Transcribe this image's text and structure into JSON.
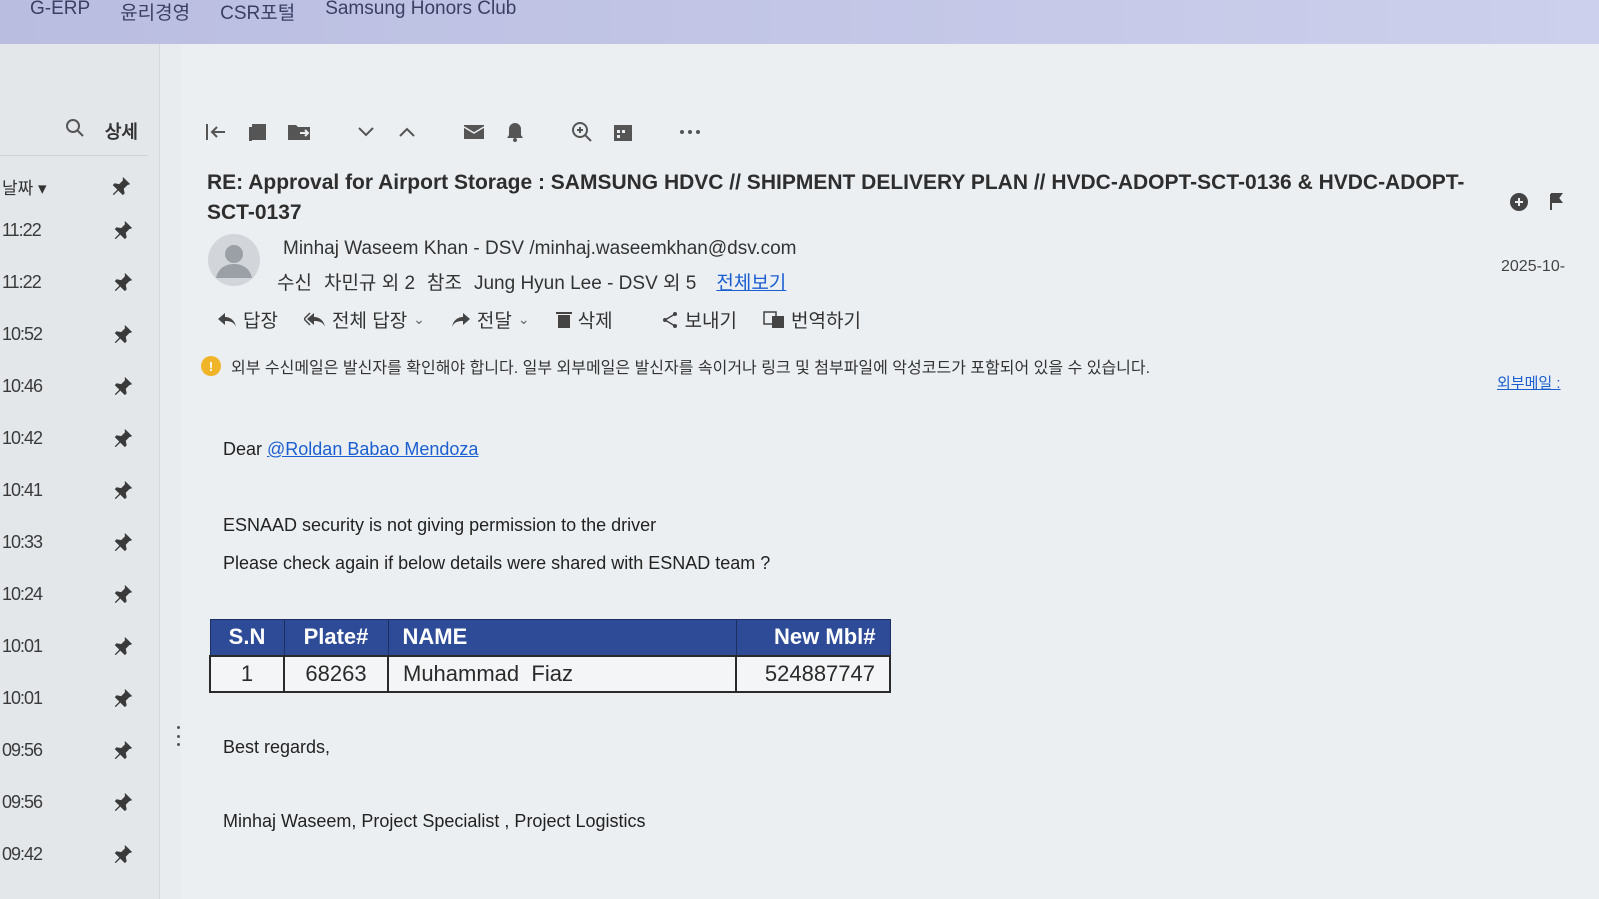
{
  "bookmarks": [
    "G-ERP",
    "윤리경영",
    "CSR포털",
    "Samsung Honors Club"
  ],
  "list_pane": {
    "detail_label": "상세",
    "sort_label": "날짜",
    "times": [
      "11:22",
      "11:22",
      "10:52",
      "10:46",
      "10:42",
      "10:41",
      "10:33",
      "10:24",
      "10:01",
      "10:01",
      "09:56",
      "09:56",
      "09:42"
    ]
  },
  "email": {
    "subject": "RE: Approval for Airport Storage : SAMSUNG HDVC // SHIPMENT DELIVERY PLAN // HVDC-ADOPT-SCT-0136 & HVDC-ADOPT-SCT-0137",
    "sender": "Minhaj Waseem Khan - DSV /minhaj.waseemkhan@dsv.com",
    "to_label": "수신",
    "to_value": "차민규 외 2",
    "cc_label": "참조",
    "cc_value": "Jung Hyun Lee - DSV 외 5",
    "view_all": "전체보기",
    "date": "2025-10-",
    "actions": {
      "reply": "답장",
      "reply_all": "전체 답장",
      "forward": "전달",
      "delete": "삭제",
      "send": "보내기",
      "translate": "번역하기"
    },
    "warning": "외부 수신메일은 발신자를 확인해야 합니다. 일부 외부메일은 발신자를 속이거나 링크 및 첨부파일에 악성코드가 포함되어 있을 수 있습니다.",
    "warning_link": "외부메일 :",
    "body": {
      "greeting": "Dear ",
      "mention": "@Roldan Babao Mendoza",
      "line1": "ESNAAD security is not giving permission to the driver",
      "line2": "Please check again if below details were shared with ESNAD team ?",
      "closing": "Best regards,",
      "signature": "Minhaj Waseem, Project Specialist , Project Logistics"
    },
    "table": {
      "headers": [
        "S.N",
        "Plate#",
        "NAME",
        "New Mbl#"
      ],
      "rows": [
        [
          "1",
          "68263",
          "Muhammad  Fiaz",
          "524887747"
        ]
      ]
    }
  },
  "colors": {
    "table_header": "#2e4b97",
    "link": "#1a5fd1",
    "warning": "#f0b429"
  }
}
